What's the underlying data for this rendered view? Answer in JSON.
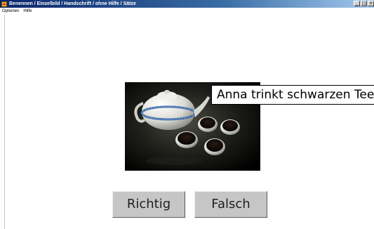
{
  "window": {
    "title": "Benennen / Einzelbild / Handschrift / ohne Hilfe / Sätze",
    "controls": [
      "_",
      "□",
      "×"
    ]
  },
  "menu": {
    "items": [
      "Optionen",
      "Hilfe"
    ]
  },
  "exercise": {
    "image_icon": "tea-set-photo",
    "sentence": "Anna trinkt schwarzen Tee.",
    "buttons": {
      "correct": "Richtig",
      "wrong": "Falsch"
    }
  }
}
